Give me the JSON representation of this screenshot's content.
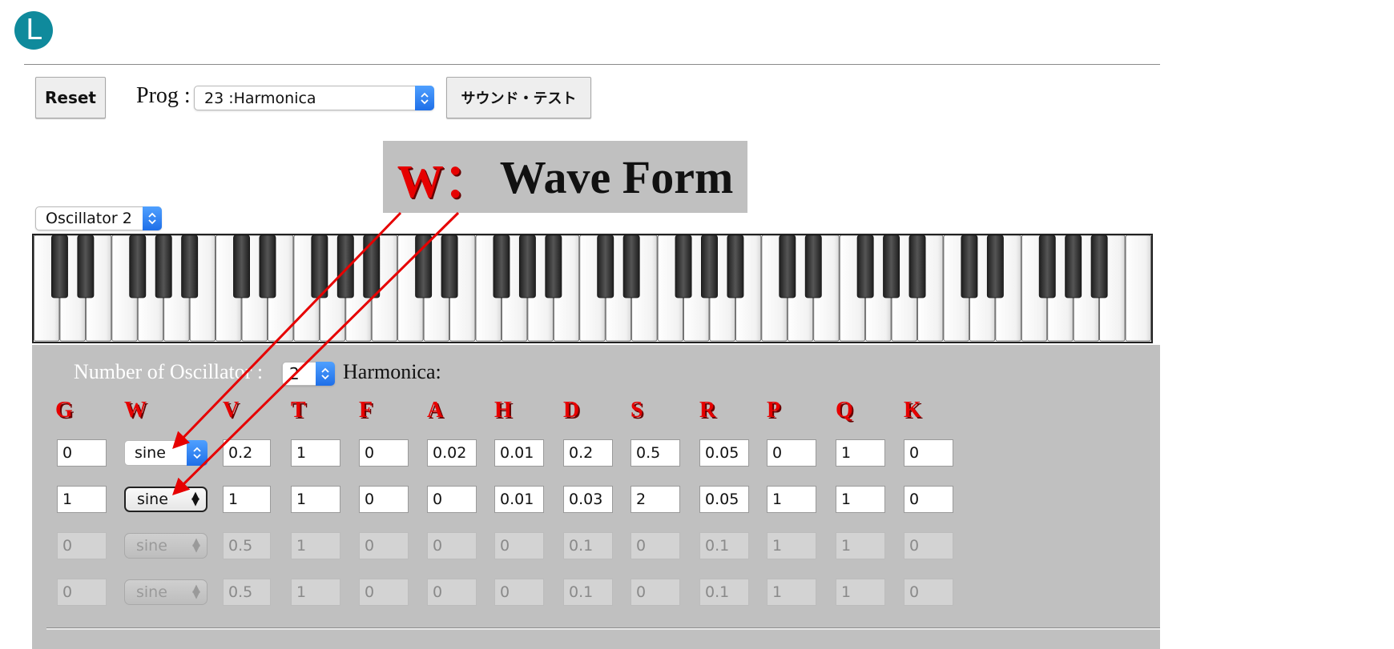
{
  "logo": {
    "letter": "L"
  },
  "toolbar": {
    "reset_label": "Reset",
    "prog_label": "Prog :",
    "prog_value": "23 :Harmonica",
    "sound_test_label": "サウンド・テスト"
  },
  "callout": {
    "w": "W：",
    "text": "Wave Form"
  },
  "oscillator_select": {
    "value": "Oscillator 2"
  },
  "panel": {
    "num_osc_label": "Number of Oscillator :",
    "num_osc_value": "2",
    "preset_name": "Harmonica:"
  },
  "columns": [
    "G",
    "W",
    "V",
    "T",
    "F",
    "A",
    "H",
    "D",
    "S",
    "R",
    "P",
    "Q",
    "K"
  ],
  "rows": [
    {
      "state": "active",
      "wave_style": "blue",
      "values": [
        "0",
        "sine",
        "0.2",
        "1",
        "0",
        "0.02",
        "0.01",
        "0.2",
        "0.5",
        "0.05",
        "0",
        "1",
        "0"
      ]
    },
    {
      "state": "active",
      "wave_style": "popup",
      "values": [
        "1",
        "sine",
        "1",
        "1",
        "0",
        "0",
        "0.01",
        "0.03",
        "2",
        "0.05",
        "1",
        "1",
        "0"
      ]
    },
    {
      "state": "disabled",
      "wave_style": "popup",
      "values": [
        "0",
        "sine",
        "0.5",
        "1",
        "0",
        "0",
        "0",
        "0.1",
        "0",
        "0.1",
        "1",
        "1",
        "0"
      ]
    },
    {
      "state": "disabled",
      "wave_style": "popup",
      "values": [
        "0",
        "sine",
        "0.5",
        "1",
        "0",
        "0",
        "0",
        "0.1",
        "0",
        "0.1",
        "1",
        "1",
        "0"
      ]
    }
  ],
  "colors": {
    "accent_red": "#e60000",
    "panel_gray": "#c0c0c0",
    "logo_teal": "#0f8a9c"
  }
}
